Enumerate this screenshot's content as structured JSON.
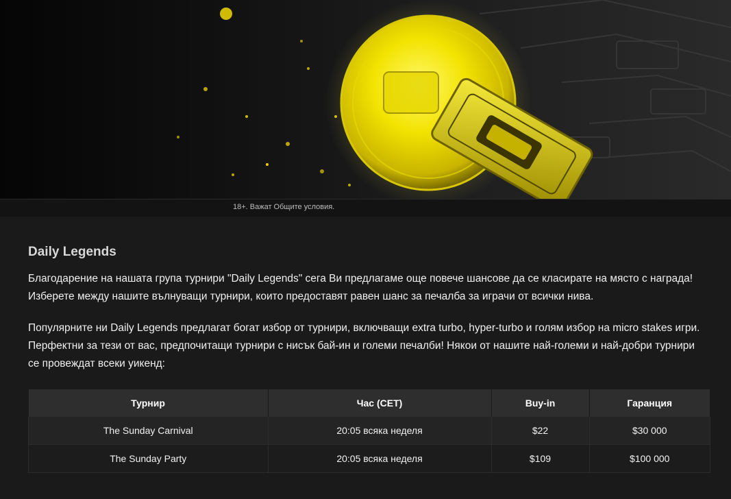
{
  "hero": {
    "disclaimer": "18+. Важат Общите условия."
  },
  "article": {
    "title": "Daily Legends",
    "paragraphs": [
      "Благодарение на нашата група турнири \"Daily Legends\" сега Ви предлагаме още повече шансове да се класирате на място с награда! Изберете между нашите вълнуващи турнири, които предоставят равен шанс за печалба за играчи от всички нива.",
      "Популярните ни Daily Legends предлагат богат избор от турнири, включващи extra turbo, hyper-turbo и голям избор на micro stakes игри. Перфектни за тези от вас, предпочитащи турнири с нисък бай-ин и големи печалби! Някои от нашите най-големи и най-добри турнири се провеждат всеки уикенд:"
    ]
  },
  "table": {
    "headers": [
      "Турнир",
      "Час (CET)",
      "Buy-in",
      "Гаранция"
    ],
    "rows": [
      [
        "The Sunday Carnival",
        "20:05 всяка неделя",
        "$22",
        "$30 000"
      ],
      [
        "The Sunday Party",
        "20:05 всяка неделя",
        "$109",
        "$100 000"
      ]
    ]
  }
}
